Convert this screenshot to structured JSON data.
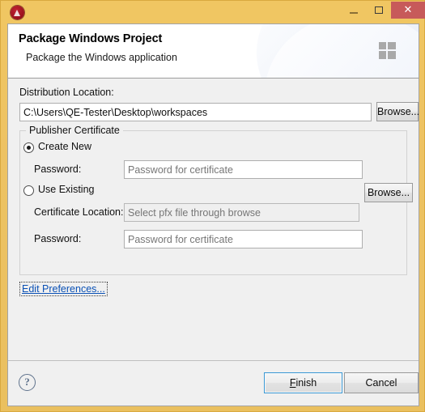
{
  "window": {
    "app_icon": "air-app-icon",
    "controls": {
      "minimize_label": "minimize-icon",
      "maximize_label": "maximize-icon",
      "close_label": "✕"
    },
    "accent_titlebar_color": "#edc263",
    "close_button_color": "#c75a5a"
  },
  "header": {
    "title": "Package Windows Project",
    "subtitle": "Package the Windows application",
    "logo": "windows-logo-icon"
  },
  "form": {
    "distribution": {
      "label": "Distribution Location:",
      "value": "C:\\Users\\QE-Tester\\Desktop\\workspaces",
      "placeholder": "",
      "browse_label": "Browse..."
    },
    "publisher_certificate": {
      "group_title": "Publisher Certificate",
      "create_new": {
        "label": "Create New",
        "selected": true,
        "password": {
          "label": "Password:",
          "value": "",
          "placeholder": "Password for certificate"
        }
      },
      "use_existing": {
        "label": "Use Existing",
        "selected": false,
        "certificate_location": {
          "label": "Certificate Location:",
          "value": "",
          "placeholder": "Select pfx file through browse",
          "browse_label": "Browse...",
          "disabled": true
        },
        "password": {
          "label": "Password:",
          "value": "",
          "placeholder": "Password for certificate"
        }
      }
    },
    "edit_preferences_link": "Edit Preferences..."
  },
  "footer": {
    "help_icon": "?",
    "finish": {
      "mnemonic": "F",
      "rest": "inish",
      "default": true,
      "focus_color": "#3c99d4"
    },
    "cancel_label": "Cancel"
  }
}
